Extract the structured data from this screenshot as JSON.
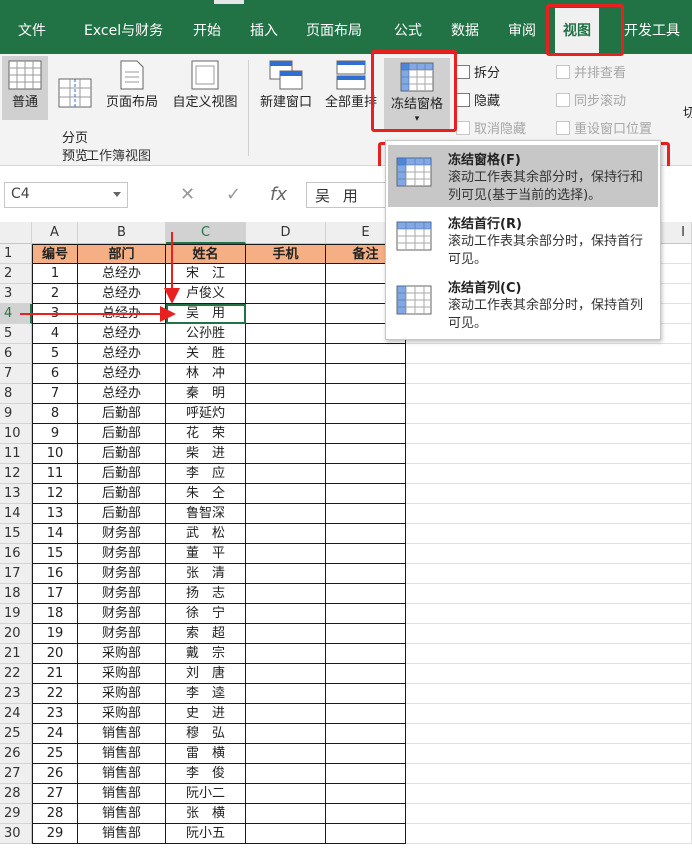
{
  "ribbon_tabs": [
    "文件",
    "Excel与财务",
    "开始",
    "插入",
    "页面布局",
    "公式",
    "数据",
    "审阅",
    "视图",
    "开发工具"
  ],
  "active_tab": "视图",
  "ribbon": {
    "group_label": "工作簿视图",
    "normal": "普通",
    "page_break": "分页\n预览",
    "page_layout": "页面布局",
    "custom_view": "自定义视图",
    "new_window": "新建窗口",
    "arrange_all": "全部重排",
    "freeze_panes": "冻结窗格",
    "split": "拆分",
    "hide": "隐藏",
    "unhide": "取消隐藏",
    "side_by_side": "并排查看",
    "sync_scroll": "同步滚动",
    "reset_position": "重设窗口位置",
    "partial": "切"
  },
  "formula_bar": {
    "name_box": "C4",
    "cancel": "✕",
    "enter": "✓",
    "fx": "fx",
    "content": "吴 用"
  },
  "columns": [
    "A",
    "B",
    "C",
    "D",
    "E",
    "I"
  ],
  "headers": [
    "编号",
    "部门",
    "姓名",
    "手机",
    "备注"
  ],
  "rows": [
    [
      "1",
      "总经办",
      "宋　江"
    ],
    [
      "2",
      "总经办",
      "卢俊义"
    ],
    [
      "3",
      "总经办",
      "吴　用"
    ],
    [
      "4",
      "总经办",
      "公孙胜"
    ],
    [
      "5",
      "总经办",
      "关　胜"
    ],
    [
      "6",
      "总经办",
      "林　冲"
    ],
    [
      "7",
      "总经办",
      "秦　明"
    ],
    [
      "8",
      "后勤部",
      "呼延灼"
    ],
    [
      "9",
      "后勤部",
      "花　荣"
    ],
    [
      "10",
      "后勤部",
      "柴　进"
    ],
    [
      "11",
      "后勤部",
      "李　应"
    ],
    [
      "12",
      "后勤部",
      "朱　仝"
    ],
    [
      "13",
      "后勤部",
      "鲁智深"
    ],
    [
      "14",
      "财务部",
      "武　松"
    ],
    [
      "15",
      "财务部",
      "董　平"
    ],
    [
      "16",
      "财务部",
      "张　清"
    ],
    [
      "17",
      "财务部",
      "扬　志"
    ],
    [
      "18",
      "财务部",
      "徐　宁"
    ],
    [
      "19",
      "财务部",
      "索　超"
    ],
    [
      "20",
      "采购部",
      "戴　宗"
    ],
    [
      "21",
      "采购部",
      "刘　唐"
    ],
    [
      "22",
      "采购部",
      "李　逵"
    ],
    [
      "23",
      "采购部",
      "史　进"
    ],
    [
      "24",
      "销售部",
      "穆　弘"
    ],
    [
      "25",
      "销售部",
      "雷　横"
    ],
    [
      "26",
      "销售部",
      "李　俊"
    ],
    [
      "27",
      "销售部",
      "阮小二"
    ],
    [
      "28",
      "销售部",
      "张　横"
    ],
    [
      "29",
      "销售部",
      "阮小五"
    ]
  ],
  "freeze_menu": [
    {
      "title": "冻结窗格(F)",
      "desc": "滚动工作表其余部分时，保持行和列可见(基于当前的选择)。"
    },
    {
      "title": "冻结首行(R)",
      "desc": "滚动工作表其余部分时，保持首行可见。"
    },
    {
      "title": "冻结首列(C)",
      "desc": "滚动工作表其余部分时，保持首列可见。"
    }
  ],
  "colors": {
    "excel_green": "#217346",
    "header_fill": "#f4b084",
    "highlight": "#e82020"
  }
}
